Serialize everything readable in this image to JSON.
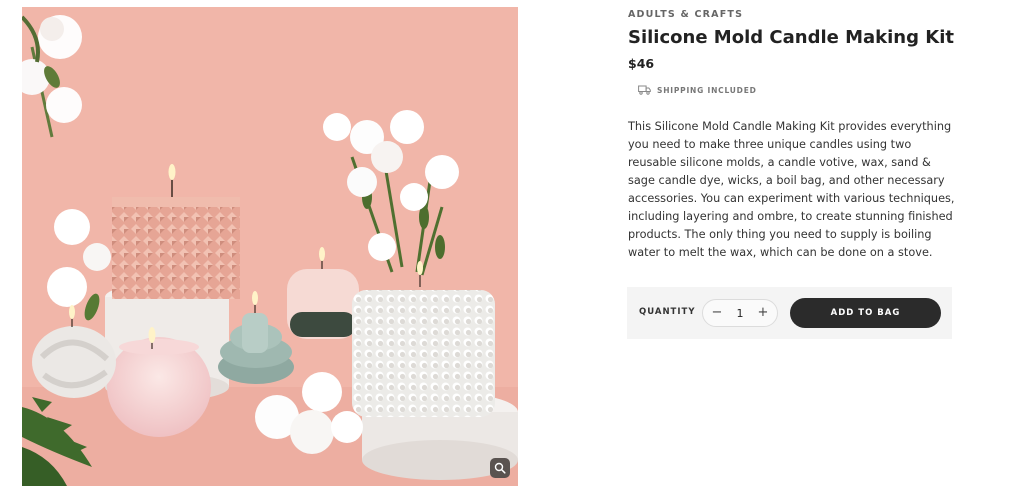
{
  "product": {
    "category": "ADULTS & CRAFTS",
    "title": "Silicone Mold Candle Making Kit",
    "price": "$46",
    "shipping_note": "SHIPPING INCLUDED",
    "shipping_icon": "truck-icon",
    "description": "This Silicone Mold Candle Making Kit provides everything you need to make three unique candles using two reusable silicone molds, a candle votive, wax, sand & sage candle dye, wicks, a boil bag, and other necessary accessories. You can experiment with various techniques, including layering and ombre, to create stunning finished products. The only thing you need to supply is boiling water to melt the wax, which can be done on a stove."
  },
  "gallery": {
    "image_alt": "Candles with flowers on pink background",
    "zoom_icon": "magnifier-icon"
  },
  "purchase": {
    "quantity_label": "QUANTITY",
    "quantity_value": "1",
    "decrement_symbol": "−",
    "increment_symbol": "+",
    "add_to_bag_label": "ADD TO BAG"
  },
  "colors": {
    "background_photo": "#f0b3a6",
    "button_dark": "#2b2b2b",
    "buy_bar_bg": "#f4f4f4"
  }
}
